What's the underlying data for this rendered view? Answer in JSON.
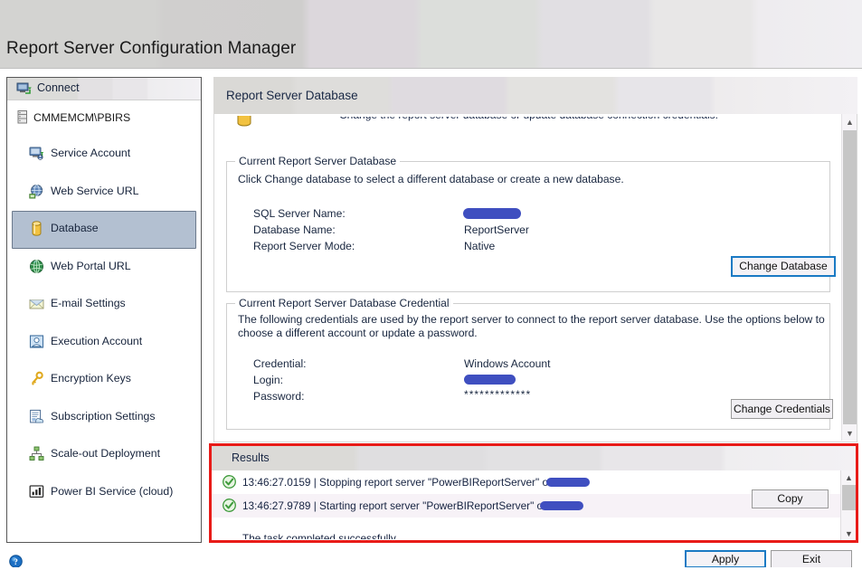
{
  "window": {
    "title": "Report Server Configuration Manager"
  },
  "sidebar": {
    "connect_label": "Connect",
    "connect_icon": "connect-server-icon",
    "root": {
      "label": "CMMEMCM\\PBIRS",
      "icon": "server-icon"
    },
    "items": [
      {
        "label": "Service Account",
        "icon": "service-account-icon",
        "selected": false
      },
      {
        "label": "Web Service URL",
        "icon": "web-service-url-icon",
        "selected": false
      },
      {
        "label": "Database",
        "icon": "database-icon",
        "selected": true
      },
      {
        "label": "Web Portal URL",
        "icon": "globe-icon",
        "selected": false
      },
      {
        "label": "E-mail Settings",
        "icon": "envelope-icon",
        "selected": false
      },
      {
        "label": "Execution Account",
        "icon": "execution-account-icon",
        "selected": false
      },
      {
        "label": "Encryption Keys",
        "icon": "key-icon",
        "selected": false
      },
      {
        "label": "Subscription Settings",
        "icon": "subscription-icon",
        "selected": false
      },
      {
        "label": "Scale-out Deployment",
        "icon": "scale-out-icon",
        "selected": false
      },
      {
        "label": "Power BI Service (cloud)",
        "icon": "power-bi-icon",
        "selected": false
      }
    ]
  },
  "content": {
    "header_title": "Report Server Database",
    "intro_clipped": "Change the report server database or update database connection credentials.",
    "database_group": {
      "title": "Current Report Server Database",
      "description": "Click Change database to select a different database or create a new database.",
      "fields": [
        {
          "label": "SQL Server Name:",
          "value": "",
          "redacted": true
        },
        {
          "label": "Database Name:",
          "value": "ReportServer",
          "redacted": false
        },
        {
          "label": "Report Server Mode:",
          "value": "Native",
          "redacted": false
        }
      ],
      "button_label": "Change Database"
    },
    "credential_group": {
      "title": "Current Report Server Database Credential",
      "description_line1": "The following credentials are used by the report server to connect to the report server database.  Use the options below to",
      "description_line2": "choose a different account or update a password.",
      "fields": [
        {
          "label": "Credential:",
          "value": "Windows Account",
          "redacted": false
        },
        {
          "label": "Login:",
          "value": "",
          "redacted": true
        },
        {
          "label": "Password:",
          "value": "*************",
          "redacted": false
        }
      ],
      "button_label": "Change Credentials"
    },
    "scrollbar": {
      "up_arrow": "chevron-up-icon",
      "down_arrow": "chevron-down-icon"
    }
  },
  "results": {
    "title": "Results",
    "copy_label": "Copy",
    "rows": [
      {
        "status_icon": "success-check-icon",
        "text_before": "13:46:27.0159 | Stopping report server \"PowerBIReportServer\" on C",
        "text_after": ".",
        "redacted": true
      },
      {
        "status_icon": "success-check-icon",
        "text_before": "13:46:27.9789 | Starting report server \"PowerBIReportServer\" on C",
        "text_after": ".",
        "redacted": true
      },
      {
        "status_icon": "",
        "text_before": "The task completed successfully.",
        "text_after": "",
        "redacted": false
      }
    ],
    "scrollbar": {
      "up_arrow": "chevron-up-icon",
      "down_arrow": "chevron-down-icon"
    }
  },
  "footer": {
    "help_icon": "help-icon",
    "apply_label": "Apply",
    "exit_label": "Exit"
  },
  "colors": {
    "accent_focus": "#1a7ac4",
    "redaction": "#3f4fc0",
    "highlight_red": "#e81b18",
    "selection": "#b3c0d1",
    "text": "#18263f"
  }
}
